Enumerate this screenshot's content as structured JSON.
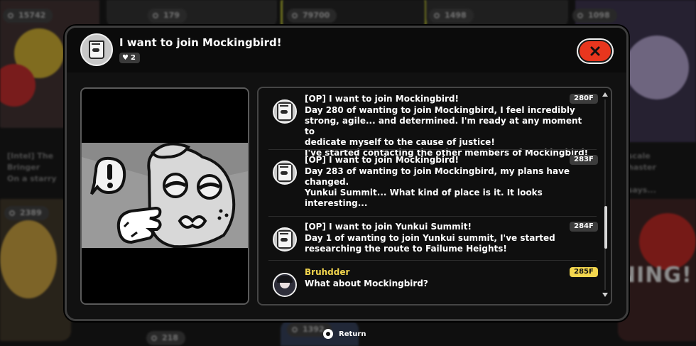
{
  "background": {
    "pills": [
      "15742",
      "179",
      "79700",
      "1498",
      "1098",
      "2389",
      "218",
      "1392"
    ],
    "texts": [
      "[Intel] The",
      "Bringer",
      "On a starry",
      "scale",
      "haster",
      "says..."
    ],
    "banner": "NING!"
  },
  "modal": {
    "title": "I want to join Mockingbird!",
    "likes": "2",
    "close_icon": "close-icon"
  },
  "replies": [
    {
      "name": "[OP] I want to join Mockingbird!",
      "floor": "280F",
      "body": "Day 280 of wanting to join Mockingbird, I feel incredibly\nstrong, agile... and determined. I'm ready at any moment to\ndedicate myself to the cause of justice!\nI've started contacting the other members of Mockingbird!"
    },
    {
      "name": "[OP] I want to join Mockingbird!",
      "floor": "283F",
      "body": "Day 283 of wanting to join Mockingbird, my plans have\nchanged.\nYunkui Summit... What kind of place is it. It looks\ninteresting..."
    },
    {
      "name": "[OP] I want to join Yunkui Summit!",
      "floor": "284F",
      "body": "Day 1 of wanting to join Yunkui summit, I've started\nresearching the route to Failume Heights!"
    },
    {
      "name": "Bruhdder",
      "floor": "285F",
      "body": "What about Mockingbird?"
    }
  ],
  "footer": {
    "return_label": "Return"
  },
  "colors": {
    "accent_close": "#e8361e",
    "highlight_floor": "#f3d64e",
    "username": "#f3d64e"
  }
}
